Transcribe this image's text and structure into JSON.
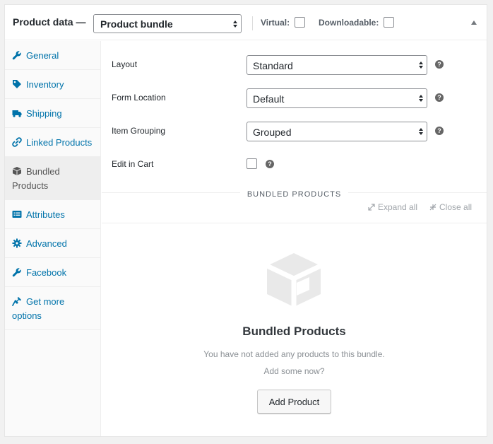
{
  "header": {
    "title": "Product data —",
    "product_type": "Product bundle",
    "virtual_label": "Virtual:",
    "downloadable_label": "Downloadable:"
  },
  "sidebar": {
    "tabs": [
      {
        "label": "General",
        "icon": "wrench-icon",
        "active": false
      },
      {
        "label": "Inventory",
        "icon": "tag-icon",
        "active": false
      },
      {
        "label": "Shipping",
        "icon": "truck-icon",
        "active": false
      },
      {
        "label": "Linked Products",
        "icon": "link-icon",
        "active": false
      },
      {
        "label": "Bundled Products",
        "icon": "box-icon",
        "active": true
      },
      {
        "label": "Attributes",
        "icon": "list-icon",
        "active": false
      },
      {
        "label": "Advanced",
        "icon": "gear-icon",
        "active": false
      },
      {
        "label": "Facebook",
        "icon": "wrench-icon",
        "active": false
      },
      {
        "label": "Get more options",
        "icon": "plugin-icon",
        "active": false
      }
    ]
  },
  "fields": {
    "layout": {
      "label": "Layout",
      "value": "Standard"
    },
    "form_location": {
      "label": "Form Location",
      "value": "Default"
    },
    "item_grouping": {
      "label": "Item Grouping",
      "value": "Grouped"
    },
    "edit_in_cart": {
      "label": "Edit in Cart",
      "checked": false
    }
  },
  "bundled": {
    "section_title": "BUNDLED PRODUCTS",
    "expand_all": "Expand all",
    "close_all": "Close all",
    "empty_title": "Bundled Products",
    "empty_text": "You have not added any products to this bundle.",
    "add_prompt": "Add some now?",
    "add_button": "Add Product"
  },
  "colors": {
    "link": "#0073aa",
    "active_tab_bg": "#eeeeee",
    "muted": "#a0a5aa"
  }
}
